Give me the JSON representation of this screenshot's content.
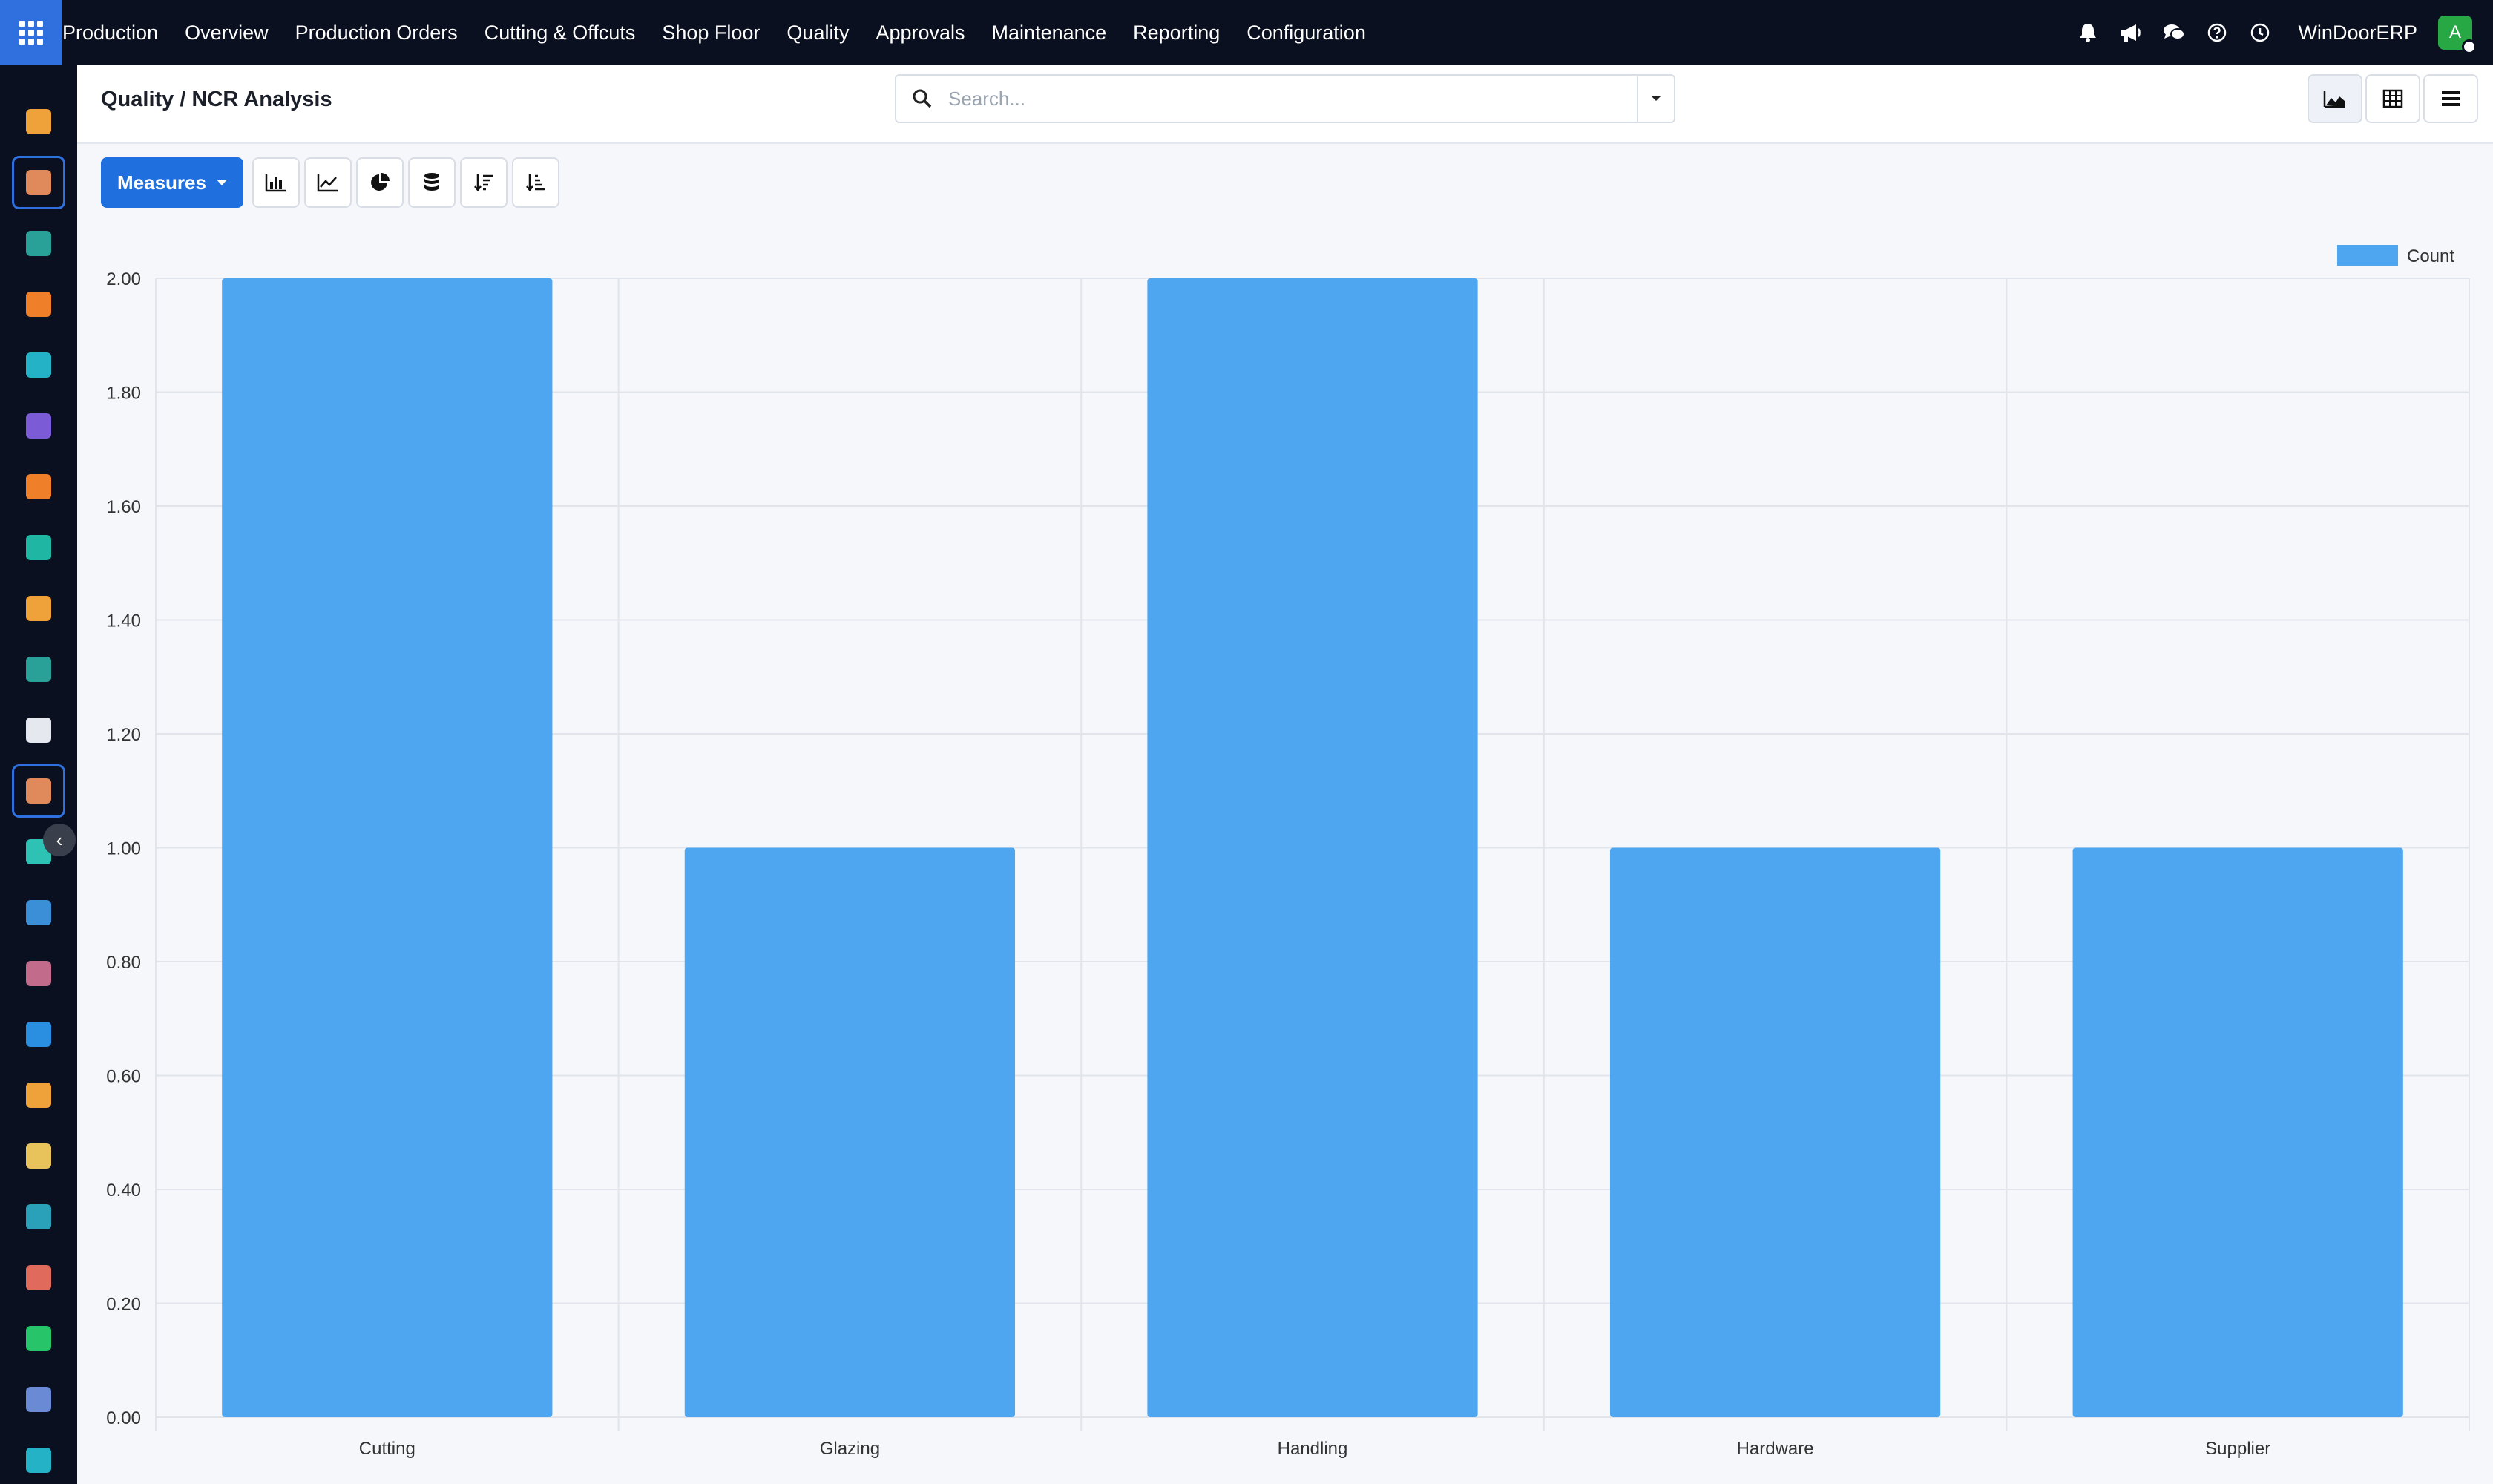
{
  "topbar": {
    "menu": [
      "Production",
      "Overview",
      "Production Orders",
      "Cutting & Offcuts",
      "Shop Floor",
      "Quality",
      "Approvals",
      "Maintenance",
      "Reporting",
      "Configuration"
    ],
    "company": "WinDoorERP",
    "avatar_letter": "A",
    "icons": [
      "bell-icon",
      "megaphone-icon",
      "chat-icon",
      "help-icon",
      "clock-icon"
    ]
  },
  "sidebar": {
    "apps": [
      {
        "name": "bars-app-icon",
        "color": "#f0a23a"
      },
      {
        "name": "spreadsheet-app-icon",
        "color": "#e08a5c",
        "active": true
      },
      {
        "name": "contacts-app-icon",
        "color": "#2aa198"
      },
      {
        "name": "discuss-app-icon",
        "color": "#f07f2a"
      },
      {
        "name": "wave-app-icon",
        "color": "#24b3c6"
      },
      {
        "name": "mail-app-icon",
        "color": "#7b5cd6"
      },
      {
        "name": "chat-app-icon",
        "color": "#f07f2a"
      },
      {
        "name": "check-app-icon",
        "color": "#1fb6a4"
      },
      {
        "name": "bars-app-icon",
        "color": "#f0a23a"
      },
      {
        "name": "contacts-app-icon",
        "color": "#2aa198"
      },
      {
        "name": "box-app-icon",
        "color": "#e6e8ef"
      },
      {
        "name": "spreadsheet-app-icon",
        "color": "#e08a5c",
        "active": true
      },
      {
        "name": "tick-app-icon",
        "color": "#2ec2b5"
      },
      {
        "name": "book-app-icon",
        "color": "#3b8fd6"
      },
      {
        "name": "cube-app-icon",
        "color": "#c26b8a"
      },
      {
        "name": "dollar-app-icon",
        "color": "#2a8fe0"
      },
      {
        "name": "people-app-icon",
        "color": "#f0a23a"
      },
      {
        "name": "calendar-app-icon",
        "color": "#e8c25a"
      },
      {
        "name": "pen-app-icon",
        "color": "#2aa1b8"
      },
      {
        "name": "dashboard-app-icon",
        "color": "#e06a5c"
      },
      {
        "name": "whatsapp-app-icon",
        "color": "#28c46a"
      },
      {
        "name": "gauge-app-icon",
        "color": "#6a8ad6"
      },
      {
        "name": "wave-app-icon",
        "color": "#24b3c6"
      }
    ]
  },
  "control": {
    "breadcrumb": "Quality / NCR Analysis",
    "search_placeholder": "Search..."
  },
  "toolbar": {
    "measures_label": "Measures"
  },
  "chart_data": {
    "type": "bar",
    "categories": [
      "Cutting",
      "Glazing",
      "Handling",
      "Hardware",
      "Supplier"
    ],
    "series": [
      {
        "name": "Count",
        "values": [
          2,
          1,
          2,
          1,
          1
        ],
        "color": "#4ea6f1"
      }
    ],
    "ylim": [
      0,
      2
    ],
    "yticks": [
      "0.00",
      "0.20",
      "0.40",
      "0.60",
      "0.80",
      "1.00",
      "1.20",
      "1.40",
      "1.60",
      "1.80",
      "2.00"
    ],
    "grid": true,
    "legend": "top-right"
  }
}
